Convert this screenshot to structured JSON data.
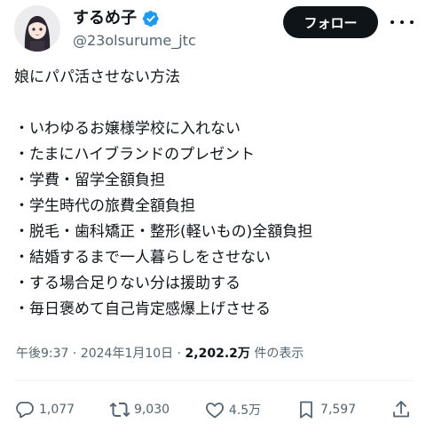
{
  "author": {
    "display_name": "するめ子",
    "handle": "@23olsurume_jtc",
    "avatar_icon": "anime-girl-avatar",
    "verified_color": "#1d9bf0"
  },
  "follow_button": {
    "label": "フォロー"
  },
  "post": {
    "title": "娘にパパ活させない方法",
    "items": [
      "・いわゆるお嬢様学校に入れない",
      "・たまにハイブランドのプレゼント",
      "・学費・留学全額負担",
      "・学生時代の旅費全額負担",
      "・脱毛・歯科矯正・整形(軽いもの)全額負担",
      "・結婚するまで一人暮らしをさせない",
      "・する場合足りない分は援助する",
      "・毎日褒めて自己肯定感爆上げさせる"
    ]
  },
  "meta": {
    "time": "午後9:37",
    "separator": " · ",
    "date": "2024年1月10日",
    "views_count": "2,202.2万",
    "views_label": " 件の表示"
  },
  "actions": {
    "replies": "1,077",
    "reposts": "9,030",
    "likes": "4.5万",
    "bookmarks": "7,597"
  },
  "colors": {
    "text": "#0f1419",
    "secondary": "#536471",
    "follow_bg": "#0f1419",
    "follow_text": "#ffffff",
    "verified": "#1d9bf0"
  }
}
